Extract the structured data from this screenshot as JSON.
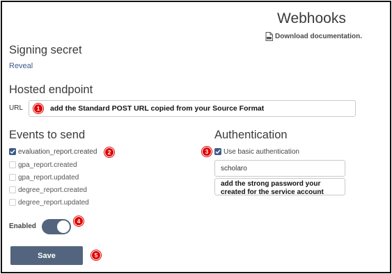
{
  "header": {
    "title": "Webhooks",
    "doc_link": {
      "icon": "pdf-icon",
      "label": "Download documentation."
    }
  },
  "signing_secret": {
    "title": "Signing secret",
    "reveal_label": "Reveal"
  },
  "hosted_endpoint": {
    "title": "Hosted endpoint",
    "url_label": "URL",
    "url_value": "add the Standard POST URL copied from your Source Format"
  },
  "events": {
    "title": "Events to send",
    "items": [
      {
        "label": "evaluation_report.created",
        "checked": true
      },
      {
        "label": "gpa_report.created",
        "checked": false
      },
      {
        "label": "gpa_report.updated",
        "checked": false
      },
      {
        "label": "degree_report.created",
        "checked": false
      },
      {
        "label": "degree_report.updated",
        "checked": false
      }
    ]
  },
  "authentication": {
    "title": "Authentication",
    "basic_auth_label": "Use basic authentication",
    "basic_auth_checked": true,
    "username_value": "scholaro",
    "password_value": "add the strong password your created for the service account"
  },
  "enabled": {
    "label": "Enabled",
    "on": true
  },
  "save_label": "Save",
  "badges": {
    "b1": "1",
    "b2": "2",
    "b3": "3",
    "b4": "4",
    "b5": "5"
  },
  "colors": {
    "accent": "#3d5a8a",
    "button": "#53657e",
    "badge": "#e00000"
  }
}
